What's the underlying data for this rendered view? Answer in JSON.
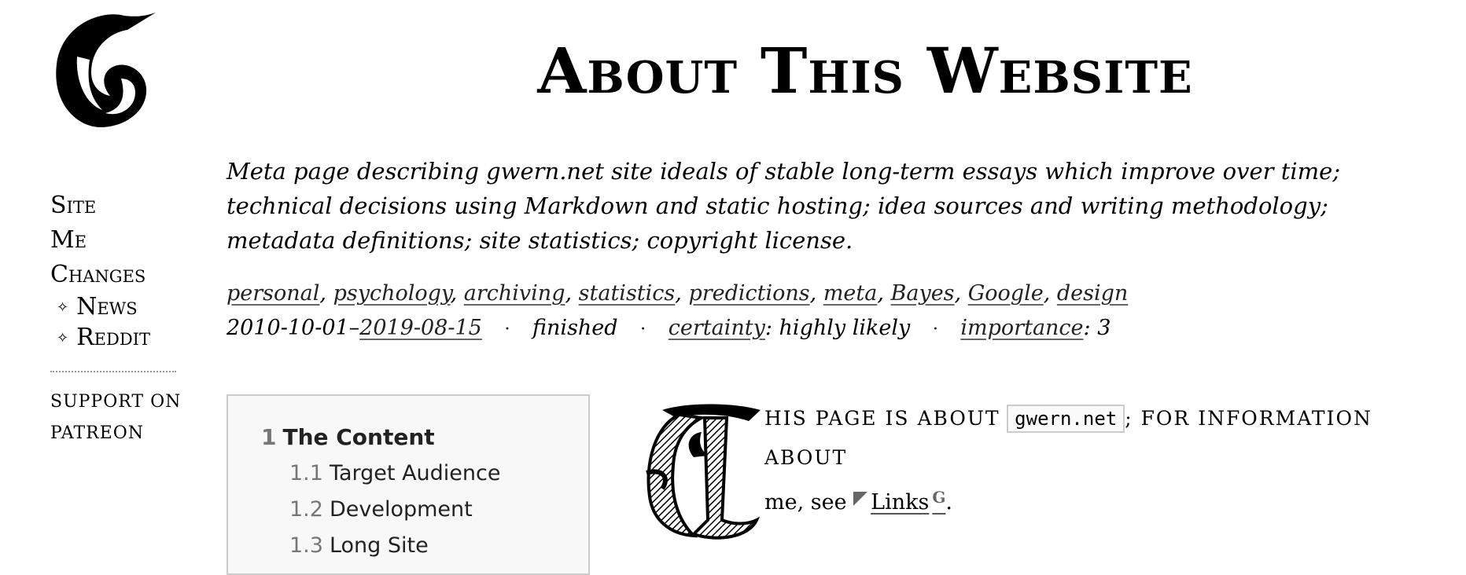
{
  "site": {
    "logo_icon": "gwern-g-logo-icon"
  },
  "page": {
    "title": "About This Website"
  },
  "sidebar": {
    "links": [
      {
        "label": "Site"
      },
      {
        "label": "Me"
      },
      {
        "label": "Changes"
      }
    ],
    "sub_links": [
      {
        "label": "News",
        "icon": "diamond-icon"
      },
      {
        "label": "Reddit",
        "icon": "diamond-icon"
      }
    ],
    "support_line1": "support on",
    "support_line2": "Patreon"
  },
  "abstract": "Meta page describing gwern.net site ideals of stable long-term essays which improve over time; technical decisions using Markdown and static hosting; idea sources and writing methodology; metadata definitions; site statistics; copyright license.",
  "tags": [
    "personal",
    "psychology",
    "archiving",
    "statistics",
    "predictions",
    "meta",
    "Bayes",
    "Google",
    "design"
  ],
  "metadata": {
    "created": "2010-10-01",
    "modified": "2019-08-15",
    "status": "finished",
    "certainty_label": "certainty",
    "certainty_value": "highly likely",
    "importance_label": "importance",
    "importance_value": "3"
  },
  "toc": [
    {
      "num": "1",
      "label": "The Content"
    },
    {
      "num": "1.1",
      "label": "Target Audience"
    },
    {
      "num": "1.2",
      "label": "Development"
    },
    {
      "num": "1.3",
      "label": "Long Site"
    }
  ],
  "intro": {
    "dropcap_letter": "T",
    "smallcaps": "his page is about",
    "site_code": "gwern.net",
    "smallcaps2": "; for information about",
    "text_before_link": "me, see",
    "link_label": "Links",
    "text_after": "."
  }
}
